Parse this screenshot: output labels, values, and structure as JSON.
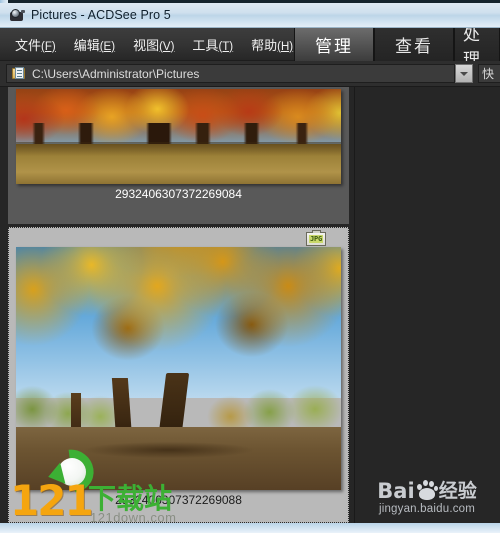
{
  "window": {
    "title": "Pictures - ACDSee Pro 5",
    "app_icon": "camera-icon"
  },
  "menubar": {
    "items": [
      {
        "label": "文件",
        "mnemonic": "(F)"
      },
      {
        "label": "编辑",
        "mnemonic": "(E)"
      },
      {
        "label": "视图",
        "mnemonic": "(V)"
      },
      {
        "label": "工具",
        "mnemonic": "(T)"
      },
      {
        "label": "帮助",
        "mnemonic": "(H)"
      }
    ]
  },
  "mode_tabs": [
    {
      "label": "管理",
      "active": true
    },
    {
      "label": "查看",
      "active": false
    },
    {
      "label": "处理",
      "active": false
    }
  ],
  "addressbar": {
    "folder_icon": "folder-icon",
    "path": "C:\\Users\\Administrator\\Pictures",
    "dropdown_icon": "chevron-down-icon",
    "quick_search_label": "快"
  },
  "thumbnails": [
    {
      "caption": "2932406307372269084",
      "selected": false,
      "file_badge": null
    },
    {
      "caption": "2932406307372269088",
      "selected": true,
      "file_badge": "JPG"
    }
  ],
  "watermarks": {
    "site": {
      "number": "121",
      "name": "下载站",
      "url": "121down.com",
      "logo_icon": "green-refresh-arrow-icon",
      "number_color": "#f5a50f",
      "name_color": "#3cb034"
    },
    "baidu": {
      "bai": "Bai",
      "paw_icon": "baidu-paw-icon",
      "jingyan": "经验",
      "url": "jingyan.baidu.com"
    }
  },
  "colors": {
    "titlebar": "#cfe0ee",
    "chrome_dark": "#2e2e2e",
    "content_bg": "#262626",
    "cell_normal": "#595959",
    "cell_selected": "#b9b9b9",
    "tab_active": "#5a5a5a"
  }
}
